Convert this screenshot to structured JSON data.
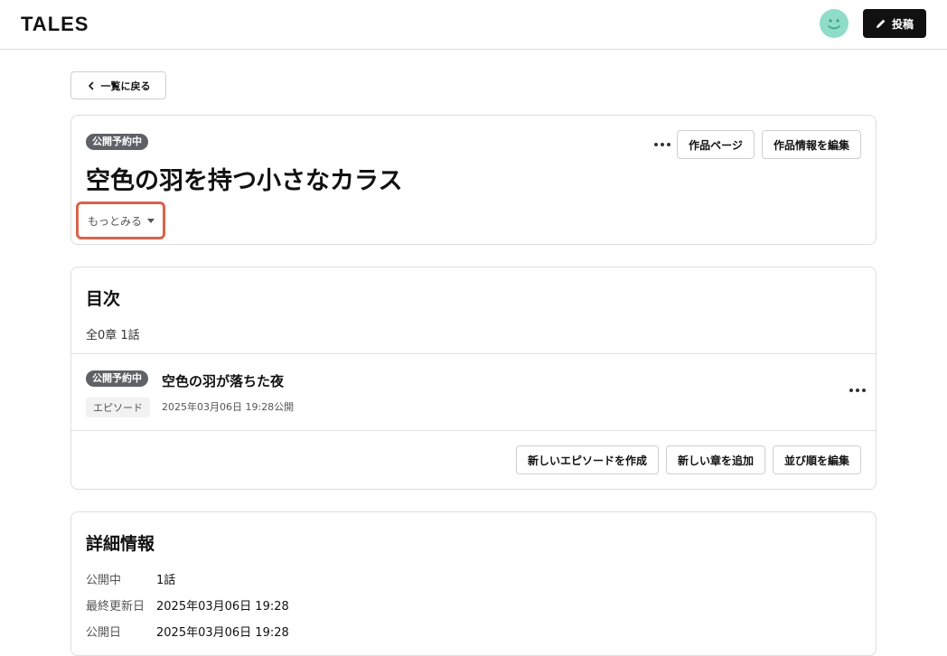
{
  "header": {
    "logo": "TALES",
    "post_label": "投稿"
  },
  "back_label": "一覧に戻る",
  "work": {
    "status_badge": "公開予約中",
    "title": "空色の羽を持つ小さなカラス",
    "work_page_label": "作品ページ",
    "edit_info_label": "作品情報を編集",
    "more_label": "もっとみる"
  },
  "toc": {
    "title": "目次",
    "count": "全0章 1話",
    "episodes": [
      {
        "status_badge": "公開予約中",
        "title": "空色の羽が落ちた夜",
        "type": "エピソード",
        "date": "2025年03月06日 19:28公開"
      }
    ],
    "new_episode_label": "新しいエピソードを作成",
    "new_chapter_label": "新しい章を追加",
    "reorder_label": "並び順を編集"
  },
  "details": {
    "title": "詳細情報",
    "rows": [
      {
        "label": "公開中",
        "value": "1話"
      },
      {
        "label": "最終更新日",
        "value": "2025年03月06日 19:28"
      },
      {
        "label": "公開日",
        "value": "2025年03月06日 19:28"
      }
    ]
  },
  "colors": {
    "accent": "#111111",
    "badge": "#5e6166",
    "avatar": "#8fdcc8",
    "highlight": "#d9634a"
  },
  "icons": [
    "pencil-icon",
    "chevron-left-icon",
    "more-horizontal-icon",
    "caret-down-icon",
    "avatar-smile-icon"
  ]
}
